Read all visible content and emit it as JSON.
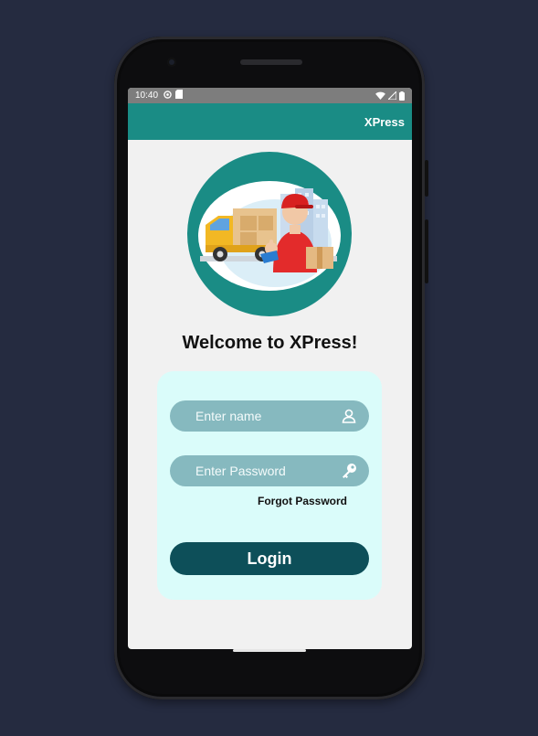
{
  "status_bar": {
    "time": "10:40"
  },
  "app_bar": {
    "title": "XPress"
  },
  "welcome": {
    "heading": "Welcome to XPress!"
  },
  "login_form": {
    "name_placeholder": "Enter name",
    "password_placeholder": "Enter Password",
    "forgot_label": "Forgot Password",
    "login_label": "Login"
  },
  "icons": {
    "name_field": "person-icon",
    "password_field": "key-icon",
    "hero": "delivery-illustration"
  },
  "colors": {
    "background": "#252b40",
    "app_bar": "#1a8c85",
    "card": "#dafcfa",
    "field": "#86b9bf",
    "login_button": "#0d4f59"
  }
}
